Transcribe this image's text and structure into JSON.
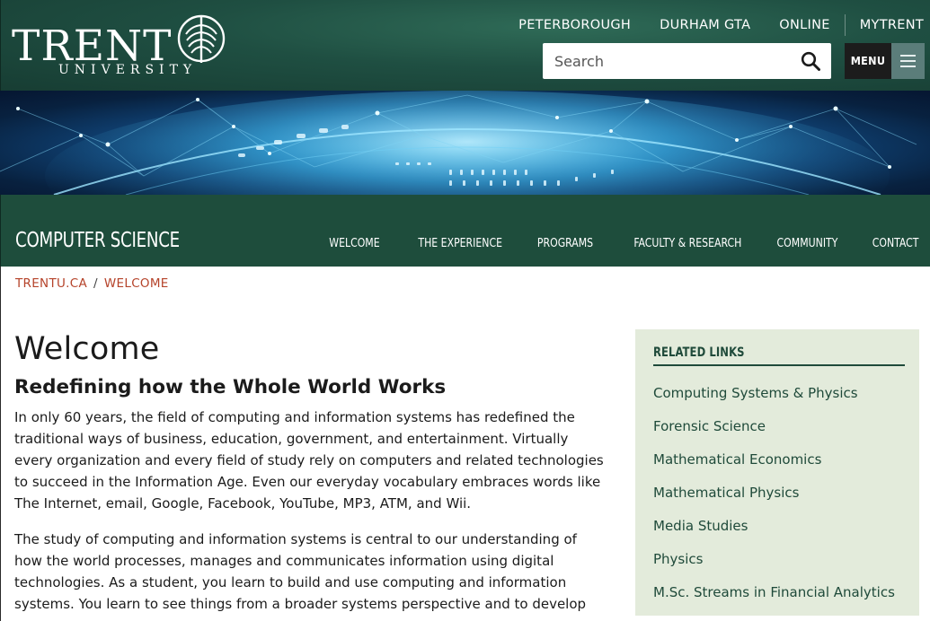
{
  "brand": {
    "logo_word": "TRENT",
    "logo_sub": "UNIVERSITY",
    "primary_color": "#1e4d3c",
    "accent_color": "#b5432a"
  },
  "campus_nav": [
    "PETERBOROUGH",
    "DURHAM GTA",
    "ONLINE",
    "MYTRENT"
  ],
  "search": {
    "placeholder": "Search",
    "icon": "search-icon"
  },
  "menu": {
    "label": "MENU",
    "icon": "hamburger-icon"
  },
  "banner": {
    "icon": "globe-network-banner"
  },
  "section": {
    "title": "COMPUTER SCIENCE",
    "nav": [
      "WELCOME",
      "THE EXPERIENCE",
      "PROGRAMS",
      "FACULTY & RESEARCH",
      "COMMUNITY",
      "CONTACT"
    ]
  },
  "breadcrumb": {
    "home": "TRENTU.CA",
    "separator": "/",
    "current": "WELCOME"
  },
  "main": {
    "title": "Welcome",
    "subtitle": "Redefining how the Whole World Works",
    "paragraphs": [
      "In only 60 years, the field of computing and information systems has redefined the traditional ways of business, education, government, and entertainment.  Virtually every organization and every field of study rely on computers and related technologies to succeed in the Information Age.  Even our everyday vocabulary embraces words like The Internet, email, Google, Facebook, YouTube, MP3, ATM, and Wii.",
      "The study of computing and information systems is central to our understanding of how the world processes, manages and communicates information using digital technologies.  As a student, you learn to build and use computing and information systems.  You learn to see things from a broader systems perspective and to develop"
    ]
  },
  "sidebar": {
    "heading": "RELATED LINKS",
    "links": [
      "Computing Systems & Physics",
      "Forensic Science",
      "Mathematical Economics",
      "Mathematical Physics",
      "Media Studies",
      "Physics",
      "M.Sc. Streams in Financial Analytics"
    ]
  }
}
